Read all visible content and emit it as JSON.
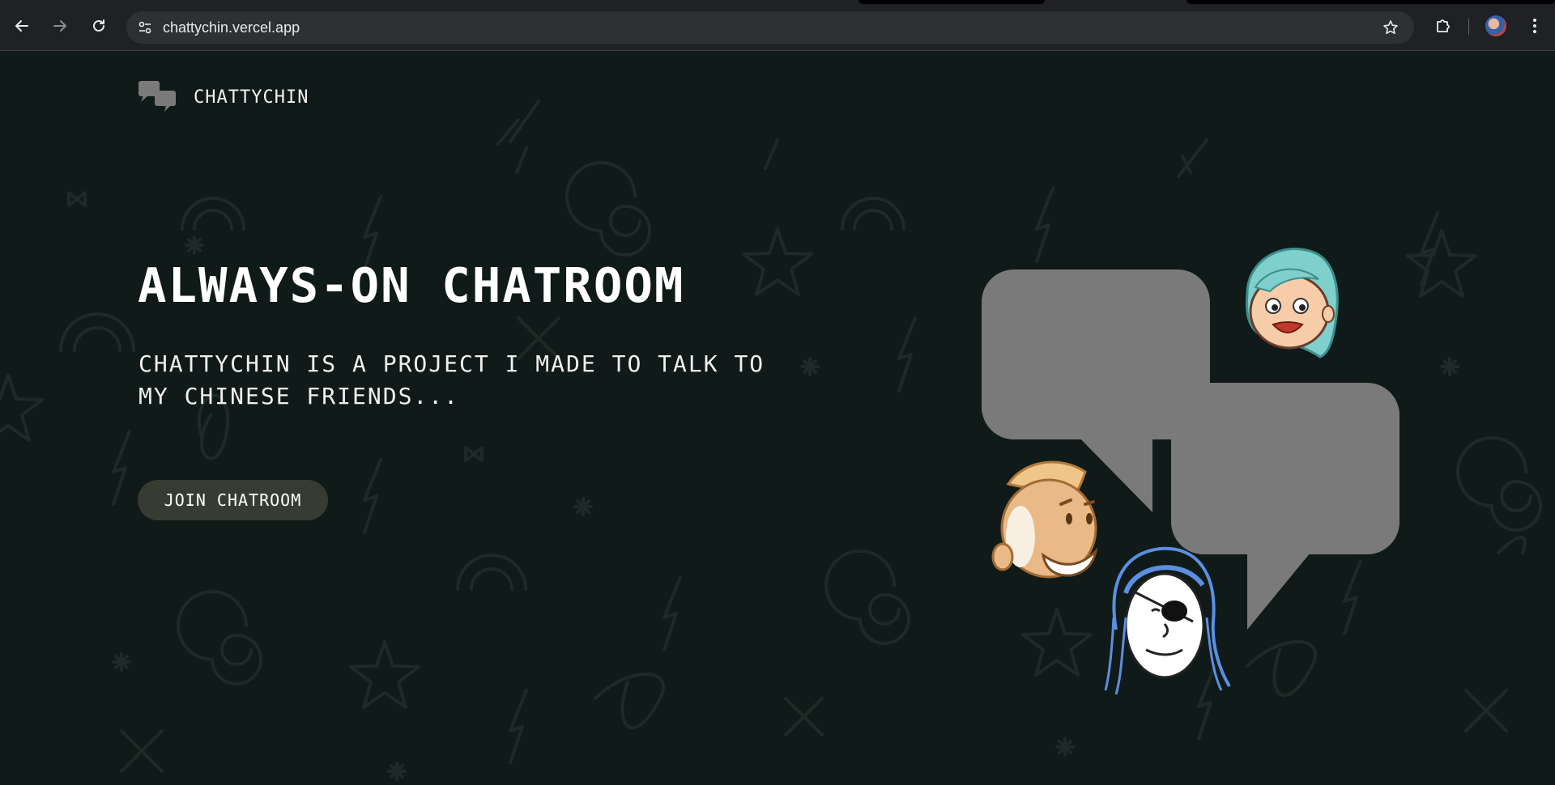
{
  "browser": {
    "url": "chattychin.vercel.app",
    "icons": {
      "back": "arrow-left-icon",
      "forward": "arrow-right-icon",
      "reload": "reload-icon",
      "site_info": "tune-icon",
      "bookmark": "star-icon",
      "extensions": "puzzle-icon",
      "profile": "avatar",
      "menu": "vertical-dots-icon"
    }
  },
  "brand": {
    "name": "CHATTYCHIN",
    "logo_icon": "chat-bubbles-icon"
  },
  "hero": {
    "title": "ALWAYS-ON CHATROOM",
    "subtitle_line1": "CHATTYCHIN IS A PROJECT I MADE TO TALK TO",
    "subtitle_line2": "MY CHINESE FRIENDS...",
    "cta_label": "JOIN CHATROOM"
  },
  "colors": {
    "background": "#101a18",
    "button": "#373c33",
    "bubble": "#7a7a7a",
    "doodle": "#1d2a27",
    "chrome": "#202124"
  }
}
